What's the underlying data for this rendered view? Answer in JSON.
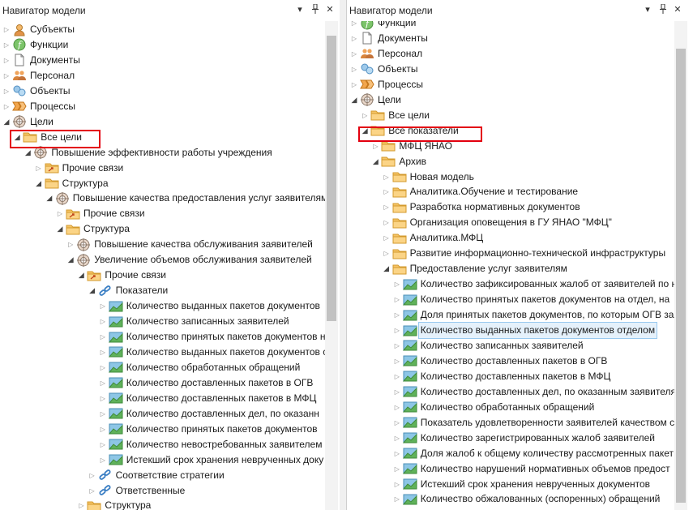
{
  "left_panel": {
    "title": "Навигатор модели",
    "buttons": {
      "dropdown": "▾",
      "pin": "📌",
      "close": "✕"
    },
    "items": [
      {
        "label": "Субъекты",
        "icon": "person-icon",
        "expanded": false
      },
      {
        "label": "Функции",
        "icon": "function-icon",
        "expanded": false
      },
      {
        "label": "Документы",
        "icon": "document-icon",
        "expanded": false
      },
      {
        "label": "Персонал",
        "icon": "staff-icon",
        "expanded": false
      },
      {
        "label": "Объекты",
        "icon": "objects-icon",
        "expanded": false
      },
      {
        "label": "Процессы",
        "icon": "process-icon",
        "expanded": false
      },
      {
        "label": "Цели",
        "icon": "target-icon",
        "expanded": true
      },
      {
        "label": "Все цели",
        "icon": "folder-icon",
        "expanded": true
      },
      {
        "label": "Повышение эффективности работы учреждения",
        "icon": "target-icon",
        "expanded": true
      },
      {
        "label": "Прочие связи",
        "icon": "folder-link-icon",
        "expanded": false
      },
      {
        "label": "Структура",
        "icon": "folder-icon",
        "expanded": true
      },
      {
        "label": "Повышение качества предоставления услуг заявителям",
        "icon": "target-icon",
        "expanded": true
      },
      {
        "label": "Прочие связи",
        "icon": "folder-link-icon",
        "expanded": false
      },
      {
        "label": "Структура",
        "icon": "folder-icon",
        "expanded": true
      },
      {
        "label": "Повышение качества обслуживания заявителей",
        "icon": "target-icon",
        "expanded": false
      },
      {
        "label": "Увеличение объемов обслуживания заявителей",
        "icon": "target-icon",
        "expanded": true
      },
      {
        "label": "Прочие связи",
        "icon": "folder-link-icon",
        "expanded": true
      },
      {
        "label": "Показатели",
        "icon": "link-icon",
        "expanded": true
      },
      {
        "label": "Количество выданных пакетов документов",
        "icon": "indicator-icon",
        "expanded": false
      },
      {
        "label": "Количество записанных заявителей",
        "icon": "indicator-icon",
        "expanded": false
      },
      {
        "label": "Количество принятых пакетов документов н",
        "icon": "indicator-icon",
        "expanded": false
      },
      {
        "label": "Количество выданных пакетов документов с",
        "icon": "indicator-icon",
        "expanded": false
      },
      {
        "label": "Количество обработанных обращений",
        "icon": "indicator-icon",
        "expanded": false
      },
      {
        "label": "Количество доставленных пакетов в ОГВ",
        "icon": "indicator-icon",
        "expanded": false
      },
      {
        "label": "Количество доставленных пакетов в МФЦ",
        "icon": "indicator-icon",
        "expanded": false
      },
      {
        "label": "Количество доставленных дел, по оказанн",
        "icon": "indicator-icon",
        "expanded": false
      },
      {
        "label": "Количество принятых пакетов документов",
        "icon": "indicator-icon",
        "expanded": false
      },
      {
        "label": "Количество невостребованных заявителем",
        "icon": "indicator-icon",
        "expanded": false
      },
      {
        "label": "Истекший срок хранения неврученных доку",
        "icon": "indicator-icon",
        "expanded": false
      },
      {
        "label": "Соответствие стратегии",
        "icon": "link-icon",
        "expanded": false
      },
      {
        "label": "Ответственные",
        "icon": "link-icon",
        "expanded": false
      },
      {
        "label": "Структура",
        "icon": "folder-icon",
        "expanded": false
      }
    ]
  },
  "right_panel": {
    "title": "Навигатор модели",
    "buttons": {
      "dropdown": "▾",
      "pin": "📌",
      "close": "✕"
    },
    "items": [
      {
        "label": "Функции",
        "icon": "function-icon",
        "expanded": false
      },
      {
        "label": "Документы",
        "icon": "document-icon",
        "expanded": false
      },
      {
        "label": "Персонал",
        "icon": "staff-icon",
        "expanded": false
      },
      {
        "label": "Объекты",
        "icon": "objects-icon",
        "expanded": false
      },
      {
        "label": "Процессы",
        "icon": "process-icon",
        "expanded": false
      },
      {
        "label": "Цели",
        "icon": "target-icon",
        "expanded": true
      },
      {
        "label": "Все цели",
        "icon": "folder-icon",
        "expanded": false
      },
      {
        "label": "Все показатели",
        "icon": "folder-icon",
        "expanded": true
      },
      {
        "label": "МФЦ ЯНАО",
        "icon": "folder-icon",
        "expanded": false
      },
      {
        "label": "Архив",
        "icon": "folder-icon",
        "expanded": true
      },
      {
        "label": "Новая модель",
        "icon": "folder-icon",
        "expanded": false
      },
      {
        "label": "Аналитика.Обучение и тестирование",
        "icon": "folder-icon",
        "expanded": false
      },
      {
        "label": "Разработка нормативных документов",
        "icon": "folder-icon",
        "expanded": false
      },
      {
        "label": "Организация оповещения в ГУ ЯНАО \"МФЦ\"",
        "icon": "folder-icon",
        "expanded": false
      },
      {
        "label": "Аналитика.МФЦ",
        "icon": "folder-icon",
        "expanded": false
      },
      {
        "label": "Развитие информационно-технической инфраструктуры",
        "icon": "folder-icon",
        "expanded": false
      },
      {
        "label": "Предоставление услуг заявителям",
        "icon": "folder-icon",
        "expanded": true
      },
      {
        "label": "Количество зафиксированных жалоб от заявителей по н",
        "icon": "indicator-icon",
        "expanded": false
      },
      {
        "label": "Количество принятых пакетов документов на отдел, на",
        "icon": "indicator-icon",
        "expanded": false
      },
      {
        "label": "Доля принятых пакетов документов, по которым ОГВ зая",
        "icon": "indicator-icon",
        "expanded": false
      },
      {
        "label": "Количество выданных пакетов документов отделом",
        "icon": "indicator-icon",
        "expanded": false
      },
      {
        "label": "Количество записанных заявителей",
        "icon": "indicator-icon",
        "expanded": false
      },
      {
        "label": "Количество доставленных пакетов в ОГВ",
        "icon": "indicator-icon",
        "expanded": false
      },
      {
        "label": "Количество доставленных пакетов в МФЦ",
        "icon": "indicator-icon",
        "expanded": false
      },
      {
        "label": "Количество доставленных дел, по оказанным заявителя",
        "icon": "indicator-icon",
        "expanded": false
      },
      {
        "label": "Количество обработанных обращений",
        "icon": "indicator-icon",
        "expanded": false
      },
      {
        "label": "Показатель удовлетворенности заявителей качеством с",
        "icon": "indicator-icon",
        "expanded": false
      },
      {
        "label": "Количество зарегистрированных жалоб заявителей",
        "icon": "indicator-icon",
        "expanded": false
      },
      {
        "label": "Доля жалоб к общему количеству рассмотренных пакет",
        "icon": "indicator-icon",
        "expanded": false
      },
      {
        "label": "Количество нарушений нормативных объемов предост",
        "icon": "indicator-icon",
        "expanded": false
      },
      {
        "label": "Истекший срок хранения неврученных документов",
        "icon": "indicator-icon",
        "expanded": false
      },
      {
        "label": "Количество обжалованных (оспоренных) обращений",
        "icon": "indicator-icon",
        "expanded": false
      }
    ]
  }
}
